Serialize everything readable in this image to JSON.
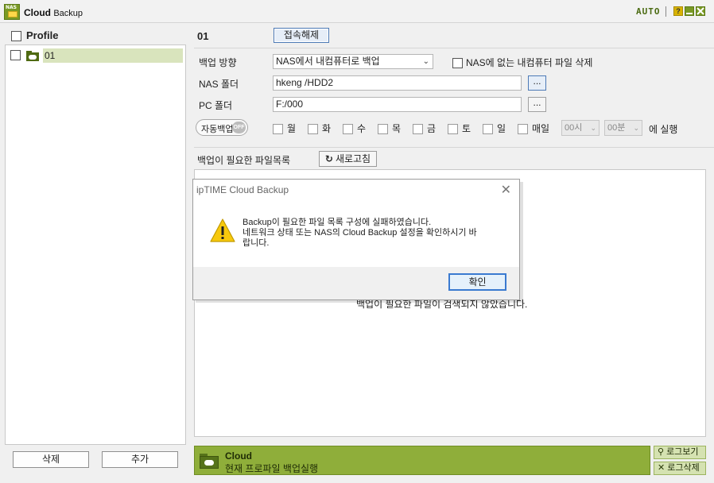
{
  "window": {
    "logo_mark": "NAS",
    "title_bold": "Cloud",
    "title_light": "Backup",
    "auto_label": "AUTO",
    "help_label": "?",
    "colors": {
      "accent_green": "#8fae3a",
      "dark_green": "#4f6a12",
      "help_yellow": "#d8b300"
    }
  },
  "left": {
    "header_label": "Profile",
    "profiles": [
      {
        "name": "01",
        "selected": true
      }
    ],
    "delete_label": "삭제",
    "add_label": "추가"
  },
  "main": {
    "profile_name": "01",
    "disconnect_label": "접속해제",
    "direction_label": "백업 방향",
    "direction_value": "NAS에서 내컴퓨터로 백업",
    "delete_missing_label": "NAS에 없는 내컴퓨터 파일 삭제",
    "nas_folder_label": "NAS 폴더",
    "nas_folder_value": "hkeng /HDD2",
    "pc_folder_label": "PC 폴더",
    "pc_folder_value": "F:/000",
    "browse_label": "...",
    "auto_backup_label": "자동백업",
    "auto_backup_state": "OFF",
    "days": [
      "월",
      "화",
      "수",
      "목",
      "금",
      "토",
      "일",
      "매일"
    ],
    "hour_value": "00시",
    "minute_value": "00분",
    "run_label": "에 실행",
    "list_label": "백업이 필요한 파일목록",
    "refresh_label": "새로고침",
    "empty_message": "백업이 필요한 파일이 검색되지 않았습니다."
  },
  "status": {
    "title": "Cloud",
    "text": "현재 프로파일 백업실행",
    "log_view_label": "로그보기",
    "log_delete_label": "로그삭제"
  },
  "dialog": {
    "title": "ipTIME Cloud Backup",
    "message_line1": "Backup이 필요한 파일 목록 구성에 실패하였습니다.",
    "message_line2": "네트워크 상태 또는 NAS의 Cloud Backup 설정을 확인하시기 바",
    "message_line3": "랍니다.",
    "ok_label": "확인"
  }
}
